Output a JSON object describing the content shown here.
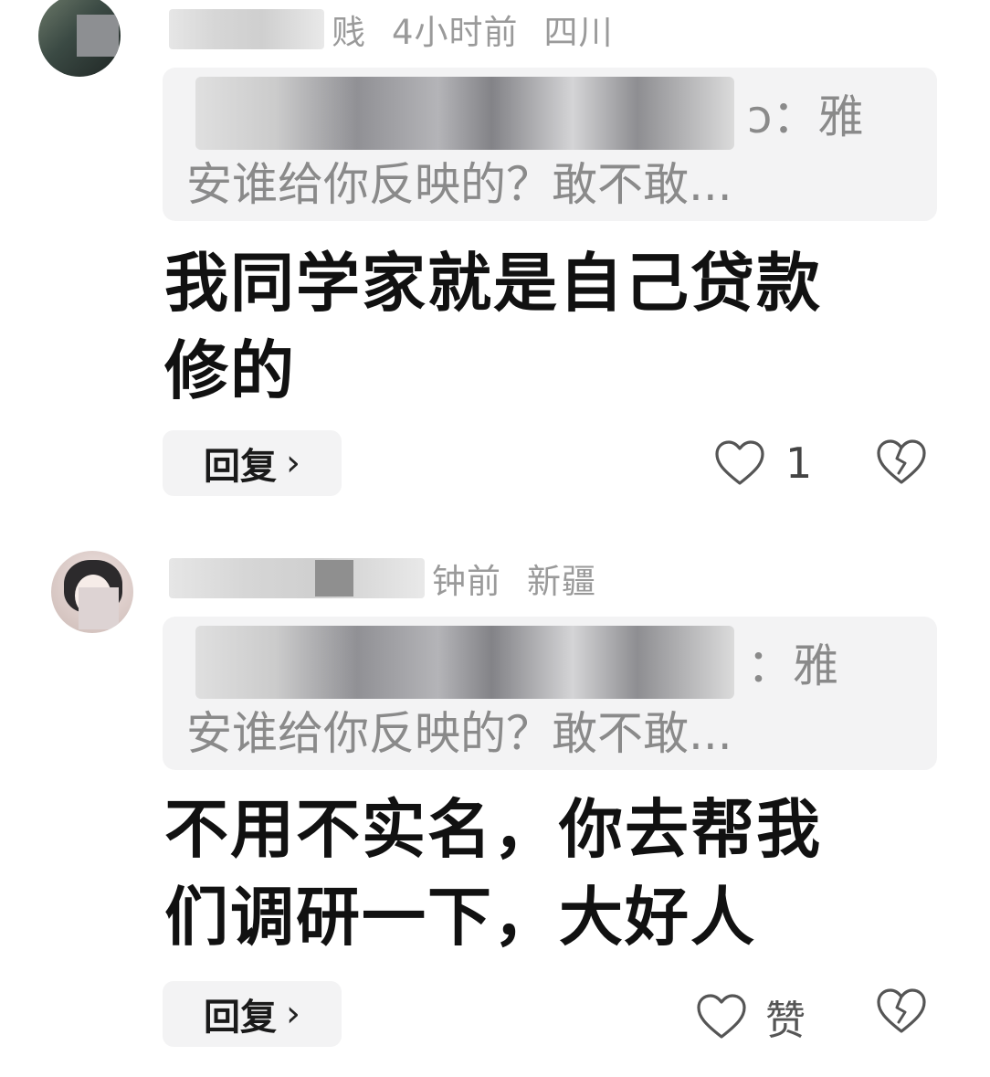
{
  "comments": [
    {
      "meta": {
        "name_tail": "贱",
        "time": "4小时前",
        "location": "四川"
      },
      "quote": {
        "line1_tail": "ɔ：雅",
        "line2": "安谁给你反映的？敢不敢..."
      },
      "body": [
        "我同学家就是自己贷款",
        "修的"
      ],
      "reply_label": "回复",
      "reply_chevron": "›",
      "like_count": "1",
      "icons": {
        "like": "heart-outline-icon",
        "dislike": "broken-heart-icon"
      }
    },
    {
      "meta": {
        "name_tail": "钟前",
        "location": "新疆"
      },
      "quote": {
        "line1_tail": "：雅",
        "line2": "安谁给你反映的？敢不敢..."
      },
      "body": [
        "不用不实名，你去帮我",
        "们调研一下，大好人"
      ],
      "reply_label": "回复",
      "reply_chevron": "›",
      "like_count": "赞",
      "icons": {
        "like": "heart-outline-icon",
        "dislike": "broken-heart-icon"
      }
    }
  ],
  "colors": {
    "meta_text": "#9a9a9a",
    "quote_bg": "#f3f3f4",
    "body_text": "#111111"
  }
}
